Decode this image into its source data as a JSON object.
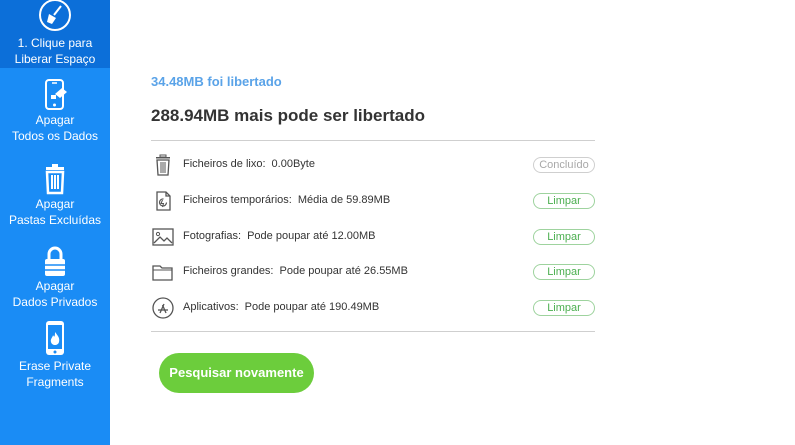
{
  "sidebar": {
    "items": [
      {
        "line1": "1. Clique para",
        "line2": "Liberar Espaço",
        "icon": "broom-icon",
        "active": true
      },
      {
        "line1": "Apagar",
        "line2": "Todos os Dados",
        "icon": "phone-erase-icon"
      },
      {
        "line1": "Apagar",
        "line2": "Pastas Excluídas",
        "icon": "trash-icon"
      },
      {
        "line1": "Apagar",
        "line2": "Dados Privados",
        "icon": "lock-icon"
      },
      {
        "line1": "Erase Private",
        "line2": "Fragments",
        "icon": "phone-fire-icon"
      }
    ],
    "colors": {
      "background": "#1a8cf5",
      "active": "#0c6fd9"
    }
  },
  "main": {
    "freed_text": "34.48MB foi libertado",
    "can_free_text": "288.94MB mais pode ser libertado",
    "rows": [
      {
        "label": "Ficheiros de lixo:",
        "value": "0.00Byte",
        "action": "Concluído",
        "icon": "trash-icon",
        "done": true
      },
      {
        "label": "Ficheiros temporários:",
        "value": "Média de 59.89MB",
        "action": "Limpar",
        "icon": "temp-file-icon"
      },
      {
        "label": "Fotografias:",
        "value": "Pode poupar até 12.00MB",
        "action": "Limpar",
        "icon": "photo-icon"
      },
      {
        "label": "Ficheiros grandes:",
        "value": "Pode poupar até 26.55MB",
        "action": "Limpar",
        "icon": "folder-icon"
      },
      {
        "label": "Aplicativos:",
        "value": "Pode poupar até 190.49MB",
        "action": "Limpar",
        "icon": "app-store-icon"
      }
    ],
    "rescan_label": "Pesquisar novamente",
    "colors": {
      "accent_green": "#6ccd3c",
      "pill_green": "#4caf50",
      "freed_blue": "#5aa3e8"
    }
  }
}
